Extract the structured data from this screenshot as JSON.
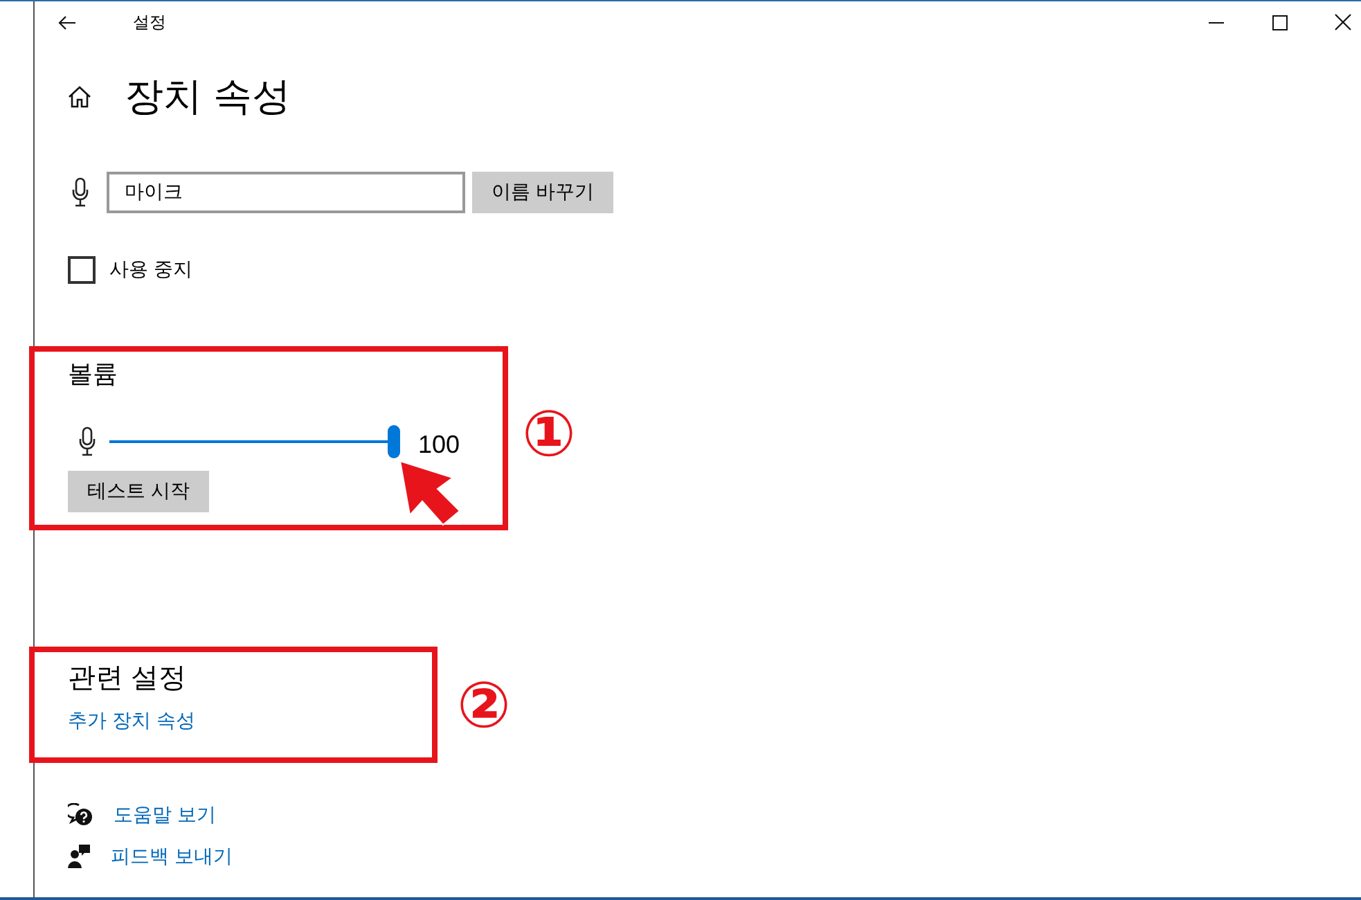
{
  "window": {
    "title": "설정"
  },
  "page": {
    "title": "장치 속성"
  },
  "device": {
    "name_value": "마이크",
    "rename_button": "이름 바꾸기"
  },
  "disable": {
    "label": "사용 중지",
    "checked": false
  },
  "volume": {
    "heading": "볼륨",
    "level": 1.0,
    "reading": "100",
    "test_button": "테스트 시작",
    "annotation": "①"
  },
  "related": {
    "heading": "관련 설정",
    "links": [
      "추가 장치 속성"
    ],
    "annotation": "②"
  },
  "help_links": [
    {
      "kind": "help",
      "label": "도움말 보기"
    },
    {
      "kind": "feedback",
      "label": "피드백 보내기"
    }
  ]
}
